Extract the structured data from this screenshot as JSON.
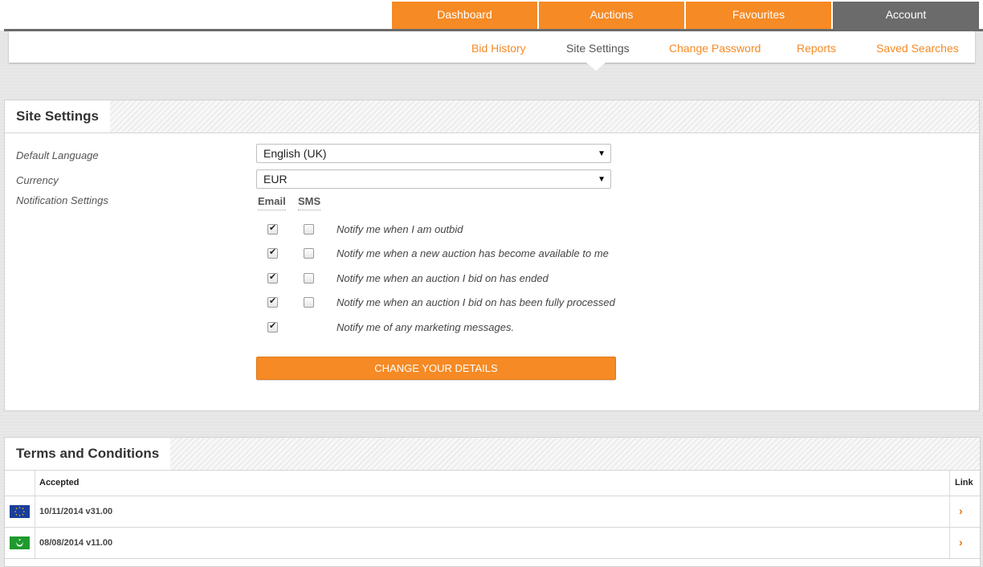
{
  "nav": {
    "tabs": [
      {
        "label": "Dashboard"
      },
      {
        "label": "Auctions"
      },
      {
        "label": "Favourites"
      },
      {
        "label": "Account"
      }
    ],
    "active_tab": "Account"
  },
  "subnav": {
    "items": [
      {
        "label": "Bid History"
      },
      {
        "label": "Site Settings"
      },
      {
        "label": "Change Password"
      },
      {
        "label": "Reports"
      },
      {
        "label": "Saved Searches"
      }
    ],
    "active_item": "Site Settings"
  },
  "site_settings": {
    "title": "Site Settings",
    "default_language_label": "Default Language",
    "default_language_value": "English (UK)",
    "currency_label": "Currency",
    "currency_value": "EUR",
    "notification_label": "Notification Settings",
    "email_header": "Email",
    "sms_header": "SMS",
    "notifications": [
      {
        "text": "Notify me when I am outbid",
        "email": true,
        "sms": false
      },
      {
        "text": "Notify me when a new auction has become available to me",
        "email": true,
        "sms": false
      },
      {
        "text": "Notify me when an auction I bid on has ended",
        "email": true,
        "sms": false
      },
      {
        "text": "Notify me when an auction I bid on has been fully processed",
        "email": true,
        "sms": false
      },
      {
        "text": "Notify me of any marketing messages.",
        "email": true,
        "sms": null
      }
    ],
    "submit_label": "CHANGE YOUR DETAILS"
  },
  "terms": {
    "title": "Terms and Conditions",
    "col_accepted": "Accepted",
    "col_link": "Link",
    "rows": [
      {
        "accepted": "10/11/2014 v31.00",
        "flag": "eu-flag-icon"
      },
      {
        "accepted": "08/08/2014 v11.00",
        "flag": "green-crescent-flag-icon"
      }
    ]
  },
  "colors": {
    "accent": "#f68a24",
    "active_tab": "#6b6b6b"
  }
}
